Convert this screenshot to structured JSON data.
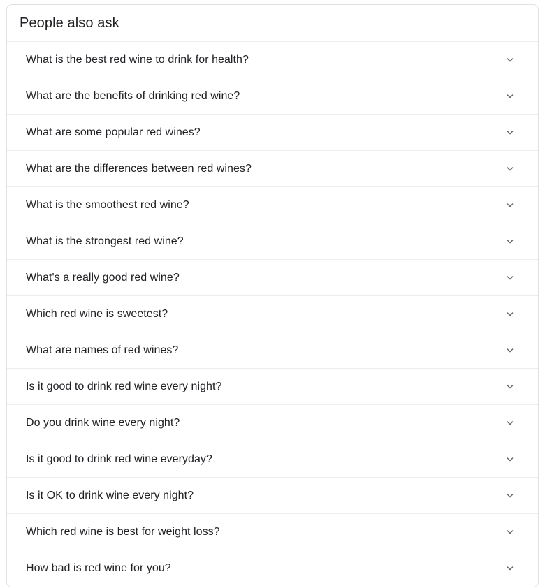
{
  "card": {
    "title": "People also ask",
    "chevron_icon": "chevron-down-icon",
    "accent_color": "#202124",
    "border_color": "#dfe1e5",
    "divider_color": "#ededed",
    "icon_color": "#5f6368",
    "background": "#ffffff",
    "questions": [
      {
        "text": "What is the best red wine to drink for health?"
      },
      {
        "text": "What are the benefits of drinking red wine?"
      },
      {
        "text": "What are some popular red wines?"
      },
      {
        "text": "What are the differences between red wines?"
      },
      {
        "text": "What is the smoothest red wine?"
      },
      {
        "text": "What is the strongest red wine?"
      },
      {
        "text": "What's a really good red wine?"
      },
      {
        "text": "Which red wine is sweetest?"
      },
      {
        "text": "What are names of red wines?"
      },
      {
        "text": "Is it good to drink red wine every night?"
      },
      {
        "text": "Do you drink wine every night?"
      },
      {
        "text": "Is it good to drink red wine everyday?"
      },
      {
        "text": "Is it OK to drink wine every night?"
      },
      {
        "text": "Which red wine is best for weight loss?"
      },
      {
        "text": "How bad is red wine for you?"
      }
    ]
  }
}
